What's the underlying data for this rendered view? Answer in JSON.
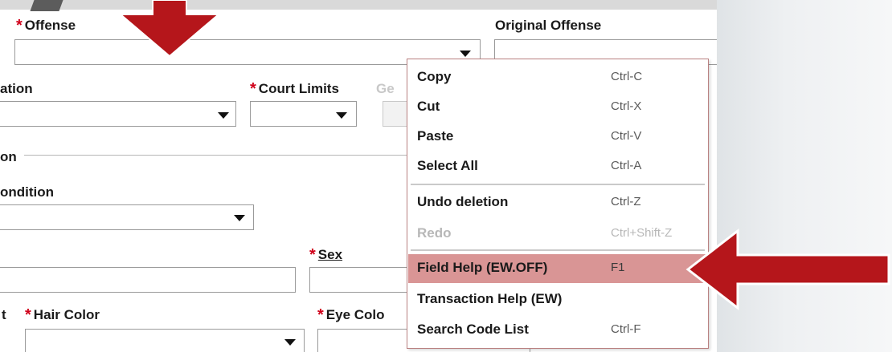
{
  "form": {
    "offense_label": "Offense",
    "original_offense_label": "Original Offense",
    "location_label": "ation",
    "court_limits_label": "Court Limits",
    "gender_label_partial": "Ge",
    "section_label": "on",
    "condition_label": "ondition",
    "sex_label": "Sex",
    "hair_color_prefix": "t",
    "hair_color_label": "Hair Color",
    "eye_color_label": "Eye Colo"
  },
  "context_menu": {
    "items": [
      {
        "label": "Copy",
        "shortcut": "Ctrl-C",
        "enabled": true
      },
      {
        "label": "Cut",
        "shortcut": "Ctrl-X",
        "enabled": true
      },
      {
        "label": "Paste",
        "shortcut": "Ctrl-V",
        "enabled": true
      },
      {
        "label": "Select All",
        "shortcut": "Ctrl-A",
        "enabled": true
      },
      {
        "label": "Undo deletion",
        "shortcut": "Ctrl-Z",
        "enabled": true
      },
      {
        "label": "Redo",
        "shortcut": "Ctrl+Shift-Z",
        "enabled": false
      },
      {
        "label": "Field Help (EW.OFF)",
        "shortcut": "F1",
        "enabled": true,
        "highlighted": true
      },
      {
        "label": "Transaction Help (EW)",
        "shortcut": "",
        "enabled": true
      },
      {
        "label": "Search Code List",
        "shortcut": "Ctrl-F",
        "enabled": true
      }
    ]
  },
  "colors": {
    "required_star": "#d0021b",
    "annotation_arrow": "#b5161b",
    "menu_highlight": "#d99595"
  }
}
